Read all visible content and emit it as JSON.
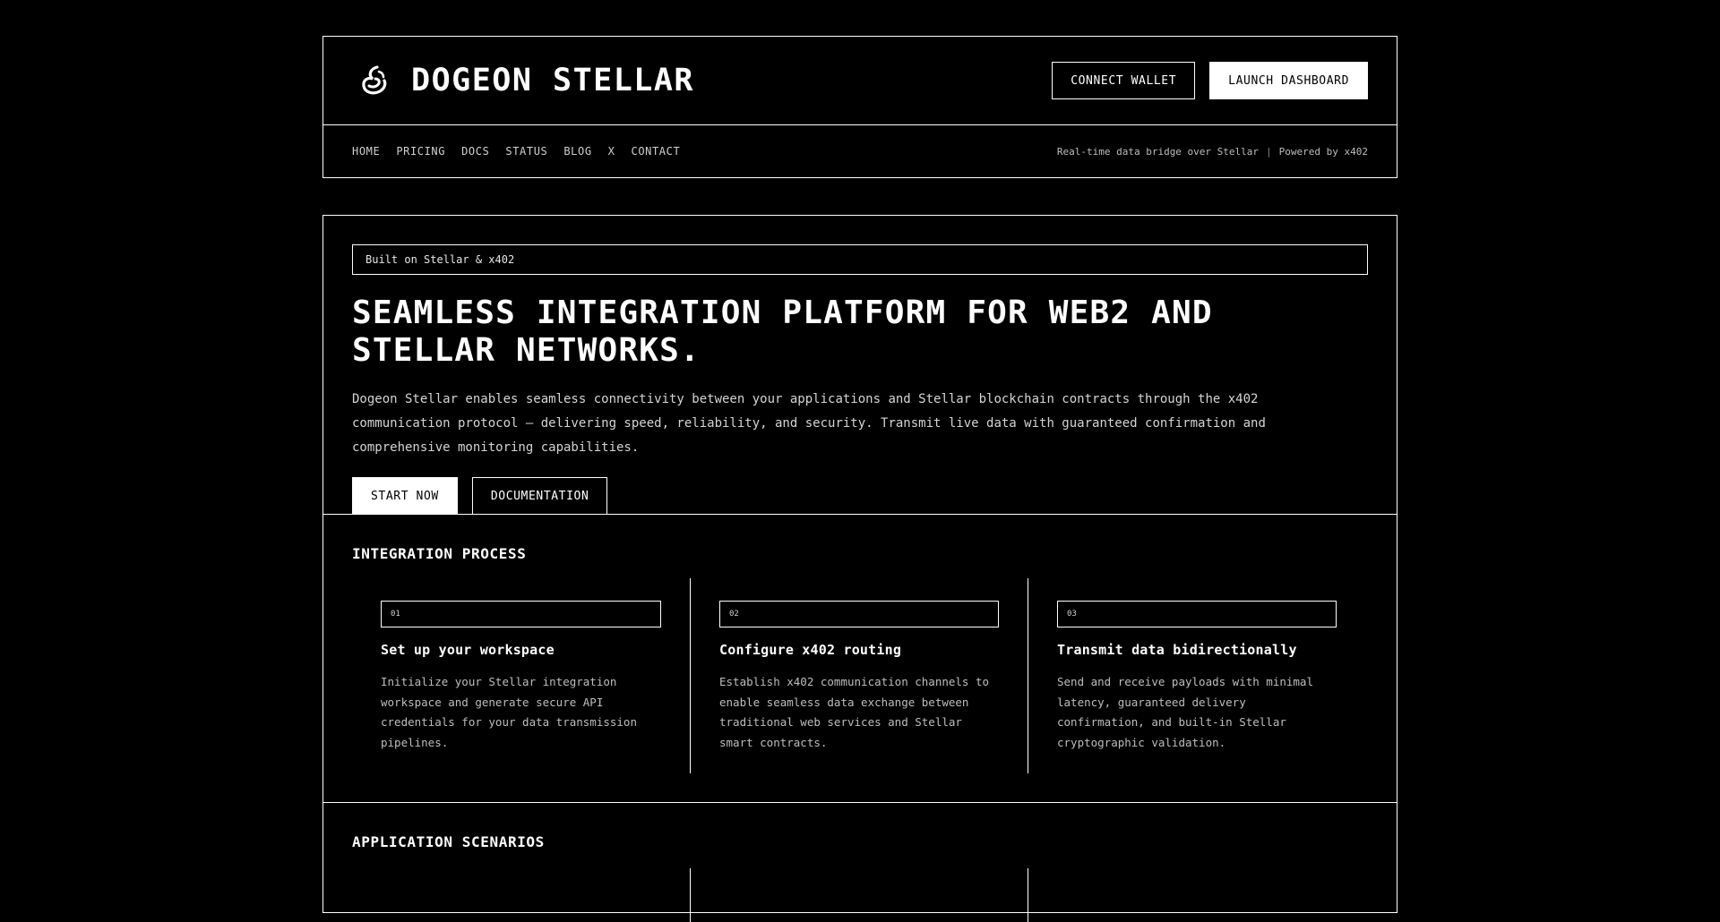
{
  "brand": {
    "name": "DOGEON STELLAR",
    "logo_icon": "stellar-swirl-icon"
  },
  "header": {
    "connect_wallet_label": "CONNECT WALLET",
    "launch_dashboard_label": "LAUNCH DASHBOARD",
    "nav": [
      "HOME",
      "PRICING",
      "DOCS",
      "STATUS",
      "BLOG",
      "X",
      "CONTACT"
    ],
    "tagline_left": "Real-time data bridge over Stellar",
    "tagline_sep": "|",
    "tagline_right": "Powered by x402"
  },
  "hero": {
    "badge": "Built on Stellar & x402",
    "title": "SEAMLESS INTEGRATION PLATFORM FOR WEB2 AND STELLAR NETWORKS.",
    "description": "Dogeon Stellar enables seamless connectivity between your applications and Stellar blockchain contracts through the x402 communication protocol — delivering speed, reliability, and security. Transmit live data with guaranteed confirmation and comprehensive monitoring capabilities.",
    "start_label": "START NOW",
    "docs_label": "DOCUMENTATION"
  },
  "process": {
    "title": "INTEGRATION PROCESS",
    "steps": [
      {
        "num": "01",
        "title": "Set up your workspace",
        "desc": "Initialize your Stellar integration workspace and generate secure API credentials for your data transmission pipelines."
      },
      {
        "num": "02",
        "title": "Configure x402 routing",
        "desc": "Establish x402 communication channels to enable seamless data exchange between traditional web services and Stellar smart contracts."
      },
      {
        "num": "03",
        "title": "Transmit data bidirectionally",
        "desc": "Send and receive payloads with minimal latency, guaranteed delivery confirmation, and built-in Stellar cryptographic validation."
      }
    ]
  },
  "scenarios": {
    "title": "APPLICATION SCENARIOS"
  },
  "colors": {
    "background": "#000000",
    "foreground": "#ffffff",
    "muted": "#bdbdbd"
  }
}
